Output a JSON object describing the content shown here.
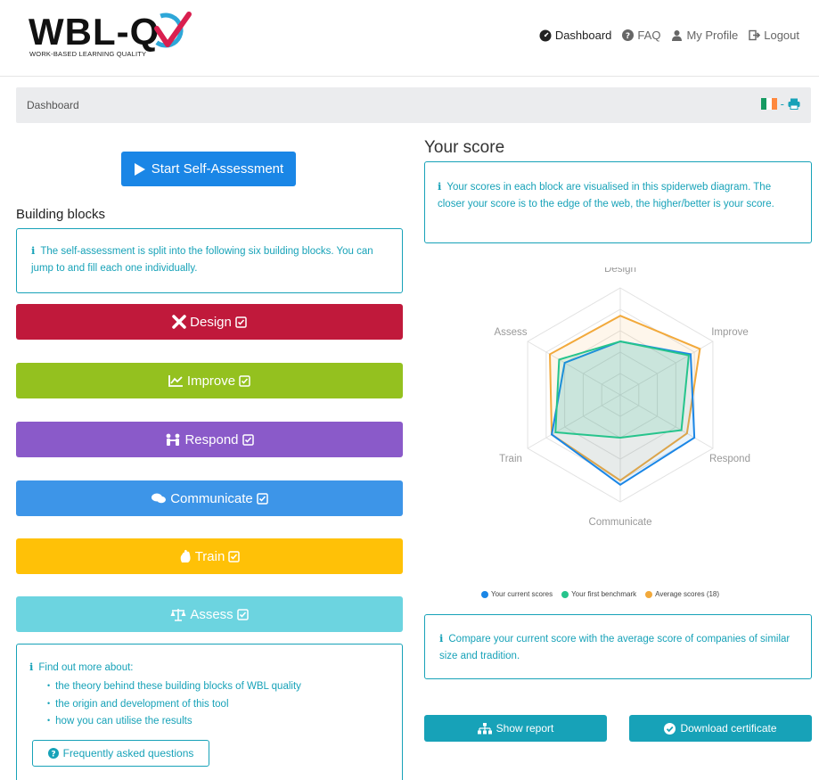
{
  "logo": {
    "text": "WBL-Q",
    "tagline": "WORK-BASED LEARNING QUALITY"
  },
  "nav": {
    "dashboard": "Dashboard",
    "faq": "FAQ",
    "profile": "My Profile",
    "logout": "Logout"
  },
  "breadcrumb": {
    "current": "Dashboard",
    "separator": "-"
  },
  "start_label": "Start Self-Assessment",
  "building_blocks": {
    "title": "Building blocks",
    "intro": "The self-assessment is split into the following six building blocks. You can jump to and fill each one individually.",
    "items": [
      {
        "label": "Design",
        "color": "#c0193b",
        "icon": "tools-icon"
      },
      {
        "label": "Improve",
        "color": "#94c11f",
        "icon": "chart-icon"
      },
      {
        "label": "Respond",
        "color": "#8a5ac9",
        "icon": "people-icon"
      },
      {
        "label": "Communicate",
        "color": "#3d95e8",
        "icon": "comments-icon"
      },
      {
        "label": "Train",
        "color": "#ffc107",
        "icon": "hand-icon"
      },
      {
        "label": "Assess",
        "color": "#6cd4e0",
        "icon": "scale-icon"
      }
    ]
  },
  "more_info": {
    "title": "Find out more about:",
    "items": [
      "the theory behind these building blocks of WBL quality",
      "the origin and development of this tool",
      "how you can utilise the results"
    ],
    "faq_button": "Frequently asked questions"
  },
  "score": {
    "title": "Your score",
    "info": "Your scores in each block are visualised in this spiderweb diagram. The closer your score is to the edge of the web, the higher/better is your score.",
    "compare": "Compare your current score with the average score of companies of similar size and tradition."
  },
  "chart_data": {
    "type": "radar",
    "axes": [
      "Design",
      "Improve",
      "Respond",
      "Communicate",
      "Train",
      "Assess"
    ],
    "max": 5,
    "series": [
      {
        "name": "Your current scores",
        "color": "#1a86e6",
        "values": [
          2.5,
          3.8,
          4.0,
          4.2,
          3.7,
          3.0
        ]
      },
      {
        "name": "Your first benchmark",
        "color": "#26c48c",
        "values": [
          2.5,
          3.7,
          3.3,
          2.0,
          3.5,
          3.3
        ]
      },
      {
        "name": "Average scores (18)",
        "color": "#f2a93b",
        "values": [
          3.7,
          4.3,
          3.6,
          4.0,
          3.7,
          3.8
        ]
      }
    ]
  },
  "buttons": {
    "report": "Show report",
    "certificate": "Download certificate"
  },
  "colors": {
    "accent": "#17a2b8",
    "primary": "#1a86e6"
  }
}
